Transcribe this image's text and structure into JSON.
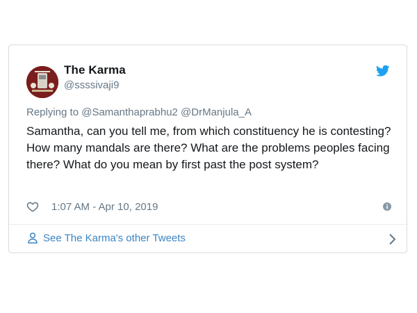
{
  "tweet": {
    "author_name": "The Karma",
    "author_handle": "@ssssivaji9",
    "replying_prefix": "Replying to",
    "replying_mentions": "@Samanthaprabhu2 @DrManjula_A",
    "text": "Samantha, can you tell me, from which constituency he is contesting? How many mandals are there? What are the problems peoples facing there? What do you mean by first past the post system?",
    "timestamp": "1:07 AM - Apr 10, 2019"
  },
  "footer": {
    "label": "See The Karma's other Tweets"
  },
  "icons": {
    "brand": "twitter-bird-icon",
    "like": "heart-icon",
    "info": "info-icon",
    "profile": "person-icon",
    "chevron": "chevron-right-icon"
  },
  "colors": {
    "twitter_blue": "#1da1f2",
    "link_blue": "#3b84c4",
    "text_primary": "#14171a",
    "text_secondary": "#657786",
    "border": "#d6dbdf",
    "avatar_bg": "#6b1b1b"
  }
}
